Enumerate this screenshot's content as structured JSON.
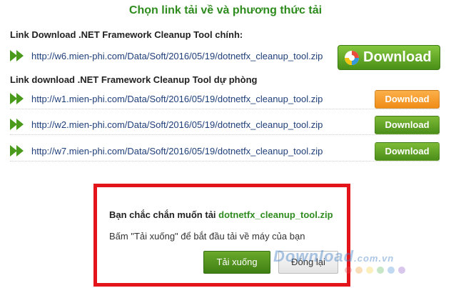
{
  "title": "Chọn link tải về và phương thức tải",
  "primary": {
    "label": "Link Download .NET Framework Cleanup Tool chính:",
    "url": "http://w6.mien-phi.com/Data/Soft/2016/05/19/dotnetfx_cleanup_tool.zip",
    "button_label": "Download"
  },
  "backup": {
    "label": "Link download .NET Framework Cleanup Tool dự phòng",
    "rows": [
      {
        "url": "http://w1.mien-phi.com/Data/Soft/2016/05/19/dotnetfx_cleanup_tool.zip",
        "button_label": "Download",
        "button_color": "#f7a12b"
      },
      {
        "url": "http://w2.mien-phi.com/Data/Soft/2016/05/19/dotnetfx_cleanup_tool.zip",
        "button_label": "Download",
        "button_color": "#5fa126"
      },
      {
        "url": "http://w7.mien-phi.com/Data/Soft/2016/05/19/dotnetfx_cleanup_tool.zip",
        "button_label": "Download",
        "button_color": "#5fa126"
      }
    ]
  },
  "dialog": {
    "question": "Bạn chắc chắn muốn tải",
    "filename": "dotnetfx_cleanup_tool.zip",
    "hint": "Bấm \"Tải xuống\" để bắt đầu tải về máy của bạn",
    "confirm_label": "Tải xuống",
    "close_label": "Đóng lại",
    "border_color": "#e4141b"
  },
  "watermark": {
    "text": "Download",
    "domain": ".com.vn",
    "dot_colors": [
      "#e35050",
      "#f0a030",
      "#f4d03f",
      "#5cb85c",
      "#4a90d9",
      "#8e5cc9"
    ]
  },
  "icons": {
    "link_arrow": "double-chevron-right-icon",
    "download_logo": "download-logo-icon"
  }
}
